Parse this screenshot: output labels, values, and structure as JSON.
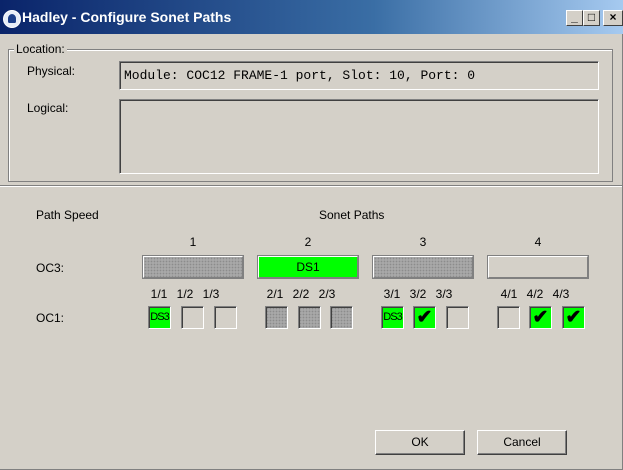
{
  "window": {
    "title": "Hadley - Configure Sonet Paths",
    "buttons": [
      "_",
      "□",
      "×"
    ]
  },
  "location": {
    "legend": "Location:",
    "physical_label": "Physical:",
    "physical_value": "Module: COC12 FRAME-1 port, Slot: 10, Port: 0",
    "logical_label": "Logical:",
    "logical_value": ""
  },
  "paths": {
    "path_speed_label": "Path Speed",
    "sonet_paths_label": "Sonet Paths",
    "groups": [
      "1",
      "2",
      "3",
      "4"
    ],
    "oc3_label": "OC3:",
    "oc1_label": "OC1:",
    "oc3": [
      {
        "text": "",
        "state": "disabled"
      },
      {
        "text": "DS1",
        "state": "green"
      },
      {
        "text": "",
        "state": "disabled"
      },
      {
        "text": "",
        "state": "empty"
      }
    ],
    "oc1_columns": [
      "1/1",
      "1/2",
      "1/3",
      "2/1",
      "2/2",
      "2/3",
      "3/1",
      "3/2",
      "3/3",
      "4/1",
      "4/2",
      "4/3"
    ],
    "oc1": [
      {
        "text": "DS3",
        "state": "green"
      },
      {
        "text": "",
        "state": "empty"
      },
      {
        "text": "",
        "state": "empty"
      },
      {
        "text": "",
        "state": "disabled"
      },
      {
        "text": "",
        "state": "disabled"
      },
      {
        "text": "",
        "state": "disabled"
      },
      {
        "text": "DS3",
        "state": "green"
      },
      {
        "text": "✔",
        "state": "green"
      },
      {
        "text": "",
        "state": "empty"
      },
      {
        "text": "",
        "state": "empty"
      },
      {
        "text": "✔",
        "state": "green"
      },
      {
        "text": "✔",
        "state": "green"
      }
    ]
  },
  "footer": {
    "ok_label": "OK",
    "cancel_label": "Cancel"
  },
  "colors": {
    "green": "#00ff00",
    "face": "#d4d0c8",
    "title_start": "#0a246a"
  }
}
